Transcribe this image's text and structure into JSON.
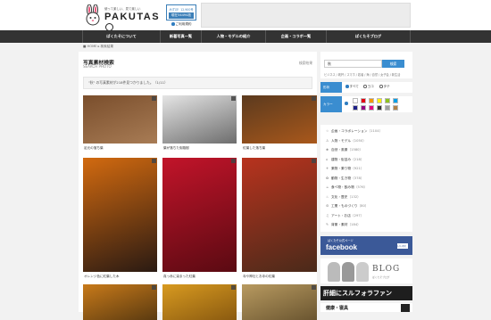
{
  "header": {
    "tagline": "使って楽しい、見て楽しい",
    "brand": "PAKUTAS",
    "stat_label": "みずほ！12,900号",
    "stat_count": "現在54494枚",
    "stat_sub": "ご利用規約"
  },
  "nav": {
    "items": [
      "ぱくたそについて",
      "新着写真一覧",
      "人物・モデルの紹介",
      "企画・コラボ一覧",
      "ぱくたそブログ"
    ]
  },
  "breadcrumb": {
    "home": "HOME",
    "current": "検索結果"
  },
  "main": {
    "title": "写真素材検索",
    "subtitle": "SEARCH PHOTO",
    "top_link": "検索結果",
    "result": "\"秋\" の写真素材が218件見つかりました。（1/11）"
  },
  "photos": [
    {
      "caption": "足元の落ち葉",
      "c1": "#7a4e2c",
      "c2": "#a87c55"
    },
    {
      "caption": "葉が落ちた街路樹",
      "c1": "#e5e5e5",
      "c2": "#6d6d6d"
    },
    {
      "caption": "紅葉した落ち葉",
      "c1": "#5b3a1e",
      "c2": "#a9581b"
    },
    {
      "caption": "オレンジ色に紅葉した木",
      "c1": "#d26a10",
      "c2": "#2a1a12"
    },
    {
      "caption": "真っ赤に染まった紅葉",
      "c1": "#c2142a",
      "c2": "#5a0a12"
    },
    {
      "caption": "寺や神社とお寺の紅葉",
      "c1": "#b8331e",
      "c2": "#4a2a1a"
    },
    {
      "caption": "",
      "c1": "#c87a1a",
      "c2": "#5a3a10"
    },
    {
      "caption": "",
      "c1": "#d89a20",
      "c2": "#8a5a10"
    },
    {
      "caption": "",
      "c1": "#b89a60",
      "c2": "#6a5530"
    }
  ],
  "sidebar": {
    "search_value": "秋",
    "search_button": "検索",
    "hint": "ビジネス / 乾杯 / スマホ / 若者 / 海 / 自然 / 女子会 / 新生活",
    "shape_label": "形状",
    "shape_options": [
      "すべて",
      "ヨコ",
      "タテ"
    ],
    "color_label": "カラー",
    "colors": [
      "#ffffff",
      "#e60012",
      "#f39800",
      "#fff100",
      "#8fc31f",
      "#00a0e9",
      "#1d2088",
      "#920783",
      "#e4007f",
      "#333333",
      "#9fa0a0",
      "#b28247"
    ],
    "categories": [
      {
        "icon": "☆",
        "label": "企画・コラボレーション",
        "count": "（1104）"
      },
      {
        "icon": "♙",
        "label": "人物・モデル",
        "count": "（1050）"
      },
      {
        "icon": "❀",
        "label": "自然・風景",
        "count": "（1580）"
      },
      {
        "icon": "⌂",
        "label": "建物・街並み",
        "count": "（218）"
      },
      {
        "icon": "✈",
        "label": "乗物・乗り物",
        "count": "（921）"
      },
      {
        "icon": "✿",
        "label": "動物・生き物",
        "count": "（378）"
      },
      {
        "icon": "☕",
        "label": "食べ物・飲み物",
        "count": "（576）"
      },
      {
        "icon": "♨",
        "label": "文化・歴史",
        "count": "（132）"
      },
      {
        "icon": "⚙",
        "label": "工業・ものづくり",
        "count": "（80）"
      },
      {
        "icon": "♫",
        "label": "アート・お店",
        "count": "（297）"
      },
      {
        "icon": "✎",
        "label": "背景・素材",
        "count": "（184）"
      }
    ],
    "fb_top": "ぱくたそ公式ページ",
    "fb_title": "facebook",
    "fb_like": "いいね！",
    "blog_title": "BLOG",
    "blog_sub": "ぱくたそブログ",
    "fan_text": "肝細にスルフォラファン",
    "bottom_text": "健康・寝具"
  }
}
